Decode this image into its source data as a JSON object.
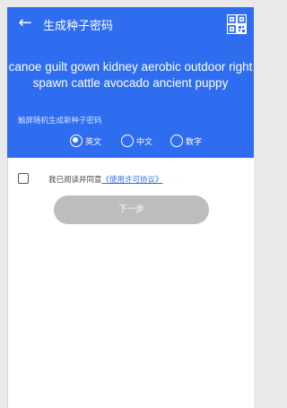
{
  "appbar": {
    "title": "生成种子密码",
    "back_icon": "arrow-left-icon",
    "qr_icon": "qr-code-icon"
  },
  "seed": {
    "mnemonic": "canoe guilt gown kidney aerobic outdoor right spawn cattle avocado ancient puppy",
    "tap_hint": "触屏随机生成新种子密码"
  },
  "language": {
    "options": [
      {
        "label": "英文",
        "selected": true
      },
      {
        "label": "中文",
        "selected": false
      },
      {
        "label": "数字",
        "selected": false
      }
    ]
  },
  "agreement": {
    "checked": false,
    "prefix": "我已阅读并同意",
    "link": "《使用许可协议》"
  },
  "next_button": {
    "label": "下一步",
    "enabled": false
  },
  "colors": {
    "primary": "#2f6df0",
    "disabled_button": "#bdbdbd"
  }
}
